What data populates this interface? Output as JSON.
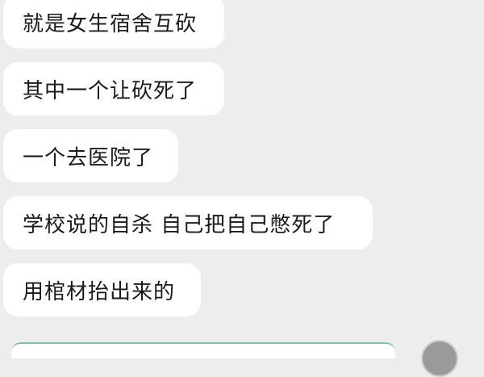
{
  "messages": [
    {
      "text": "就是女生宿舍互砍"
    },
    {
      "text": "其中一个让砍死了"
    },
    {
      "text": "一个去医院了"
    },
    {
      "text": "学校说的自杀 自己把自己憋死了"
    },
    {
      "text": "用棺材抬出来的"
    }
  ],
  "colors": {
    "background": "#ededed",
    "bubble": "#ffffff",
    "text": "#1a1a1a"
  }
}
